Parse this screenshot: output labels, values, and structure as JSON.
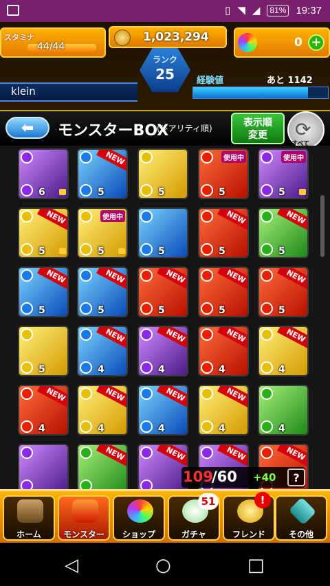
{
  "status_bar": {
    "battery": "81%",
    "time": "19:37"
  },
  "header": {
    "stamina_label": "スタミナ",
    "stamina": "44/44",
    "stamina_level": 1.0,
    "gold": "1,023,294",
    "orbs": "0",
    "orbs_add": "+",
    "rank_label": "ランク",
    "rank": "25",
    "player_name": "klein",
    "exp_label": "経験値",
    "exp_remaining": "あと 1142",
    "exp_progress": 0.85
  },
  "title_bar": {
    "back_label": "⬅",
    "title": "モンスターBOX",
    "subtitle": "(レアリティ順)",
    "sort_label_1": "表示順",
    "sort_label_2": "変更",
    "all_label": "すべて",
    "all_icon": "⟳"
  },
  "monsters": [
    {
      "element": "dark",
      "stars": "6",
      "lock": true,
      "badge": ""
    },
    {
      "element": "water",
      "stars": "5",
      "lock": false,
      "badge": "NEW"
    },
    {
      "element": "light",
      "stars": "5",
      "lock": false,
      "badge": ""
    },
    {
      "element": "fire",
      "stars": "5",
      "lock": false,
      "badge": "使用中"
    },
    {
      "element": "dark",
      "stars": "5",
      "lock": true,
      "badge": "使用中"
    },
    {
      "element": "light",
      "stars": "5",
      "lock": true,
      "badge": "NEW"
    },
    {
      "element": "light",
      "stars": "5",
      "lock": true,
      "badge": "使用中"
    },
    {
      "element": "water",
      "stars": "5",
      "lock": false,
      "badge": ""
    },
    {
      "element": "fire",
      "stars": "5",
      "lock": false,
      "badge": "NEW"
    },
    {
      "element": "wood",
      "stars": "5",
      "lock": false,
      "badge": "NEW"
    },
    {
      "element": "water",
      "stars": "5",
      "lock": false,
      "badge": "NEW"
    },
    {
      "element": "water",
      "stars": "5",
      "lock": false,
      "badge": "NEW"
    },
    {
      "element": "fire",
      "stars": "5",
      "lock": false,
      "badge": "NEW"
    },
    {
      "element": "fire",
      "stars": "5",
      "lock": false,
      "badge": "NEW"
    },
    {
      "element": "fire",
      "stars": "5",
      "lock": false,
      "badge": "NEW"
    },
    {
      "element": "light",
      "stars": "5",
      "lock": false,
      "badge": ""
    },
    {
      "element": "water",
      "stars": "4",
      "lock": false,
      "badge": "NEW"
    },
    {
      "element": "dark",
      "stars": "4",
      "lock": false,
      "badge": "NEW"
    },
    {
      "element": "fire",
      "stars": "4",
      "lock": false,
      "badge": "NEW"
    },
    {
      "element": "light",
      "stars": "4",
      "lock": false,
      "badge": "NEW"
    },
    {
      "element": "fire",
      "stars": "4",
      "lock": false,
      "badge": "NEW"
    },
    {
      "element": "light",
      "stars": "4",
      "lock": false,
      "badge": "NEW"
    },
    {
      "element": "water",
      "stars": "4",
      "lock": false,
      "badge": "NEW"
    },
    {
      "element": "light",
      "stars": "4",
      "lock": false,
      "badge": "NEW"
    },
    {
      "element": "wood",
      "stars": "4",
      "lock": false,
      "badge": ""
    },
    {
      "element": "dark",
      "stars": "",
      "lock": false,
      "badge": ""
    },
    {
      "element": "wood",
      "stars": "",
      "lock": false,
      "badge": "NEW"
    },
    {
      "element": "dark",
      "stars": "",
      "lock": false,
      "badge": "NEW"
    },
    {
      "element": "dark",
      "stars": "",
      "lock": false,
      "badge": "NEW"
    },
    {
      "element": "fire",
      "stars": "",
      "lock": false,
      "badge": "NEW"
    }
  ],
  "box_count": {
    "current": "109",
    "max": "/60",
    "extra": "+40",
    "help": "?"
  },
  "nav": {
    "home": "ホーム",
    "monster": "モンスター",
    "shop": "ショップ",
    "gacha": "ガチャ",
    "gacha_badge": "51",
    "friend": "フレンド",
    "friend_badge": "!",
    "other": "その他"
  },
  "system_nav": {
    "back": "◁",
    "home": "○",
    "recent": "□"
  }
}
